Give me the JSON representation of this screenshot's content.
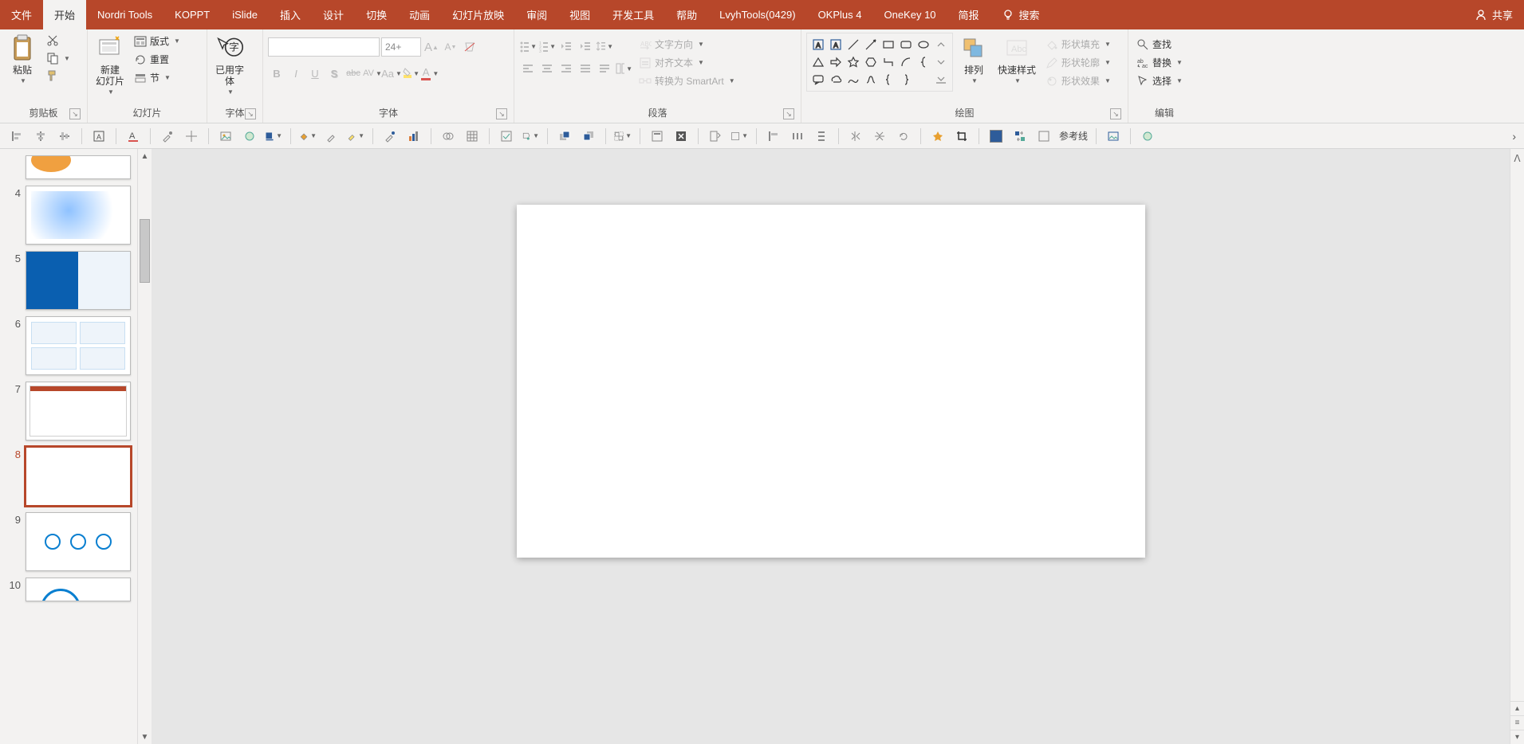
{
  "tabs": {
    "file": "文件",
    "home": "开始",
    "nordri": "Nordri Tools",
    "koppt": "KOPPT",
    "islide": "iSlide",
    "insert": "插入",
    "design": "设计",
    "transition": "切换",
    "animation": "动画",
    "slideshow": "幻灯片放映",
    "review": "审阅",
    "view": "视图",
    "dev": "开发工具",
    "help": "帮助",
    "lvyh": "LvyhTools(0429)",
    "okplus": "OKPlus 4",
    "onekey": "OneKey 10",
    "jianbao": "简报",
    "tell_me": "搜索",
    "share": "共享"
  },
  "clipboard": {
    "paste": "粘贴",
    "group": "剪贴板"
  },
  "slides": {
    "new_slide": "新建\n幻灯片",
    "layout": "版式",
    "reset": "重置",
    "section": "节",
    "group": "幻灯片"
  },
  "usedfont": {
    "label": "已用字\n体",
    "group": "字体"
  },
  "font": {
    "size_value": "24+",
    "group": "字体",
    "bold": "B",
    "italic": "I",
    "underline": "U",
    "shadow": "S",
    "strike": "abc",
    "spacing": "AV",
    "case": "Aa",
    "clear": "A"
  },
  "paragraph": {
    "group": "段落",
    "text_dir": "文字方向",
    "align_text": "对齐文本",
    "smartart": "转换为 SmartArt"
  },
  "drawing": {
    "group": "绘图",
    "arrange": "排列",
    "quick_styles": "快速样式",
    "fill": "形状填充",
    "outline": "形状轮廓",
    "effects": "形状效果"
  },
  "editing": {
    "group": "编辑",
    "find": "查找",
    "replace": "替换",
    "select": "选择"
  },
  "qat": {
    "guides": "参考线"
  },
  "thumbs": {
    "n4": "4",
    "n5": "5",
    "n6": "6",
    "n7": "7",
    "n8": "8",
    "n9": "9",
    "n10": "10"
  }
}
